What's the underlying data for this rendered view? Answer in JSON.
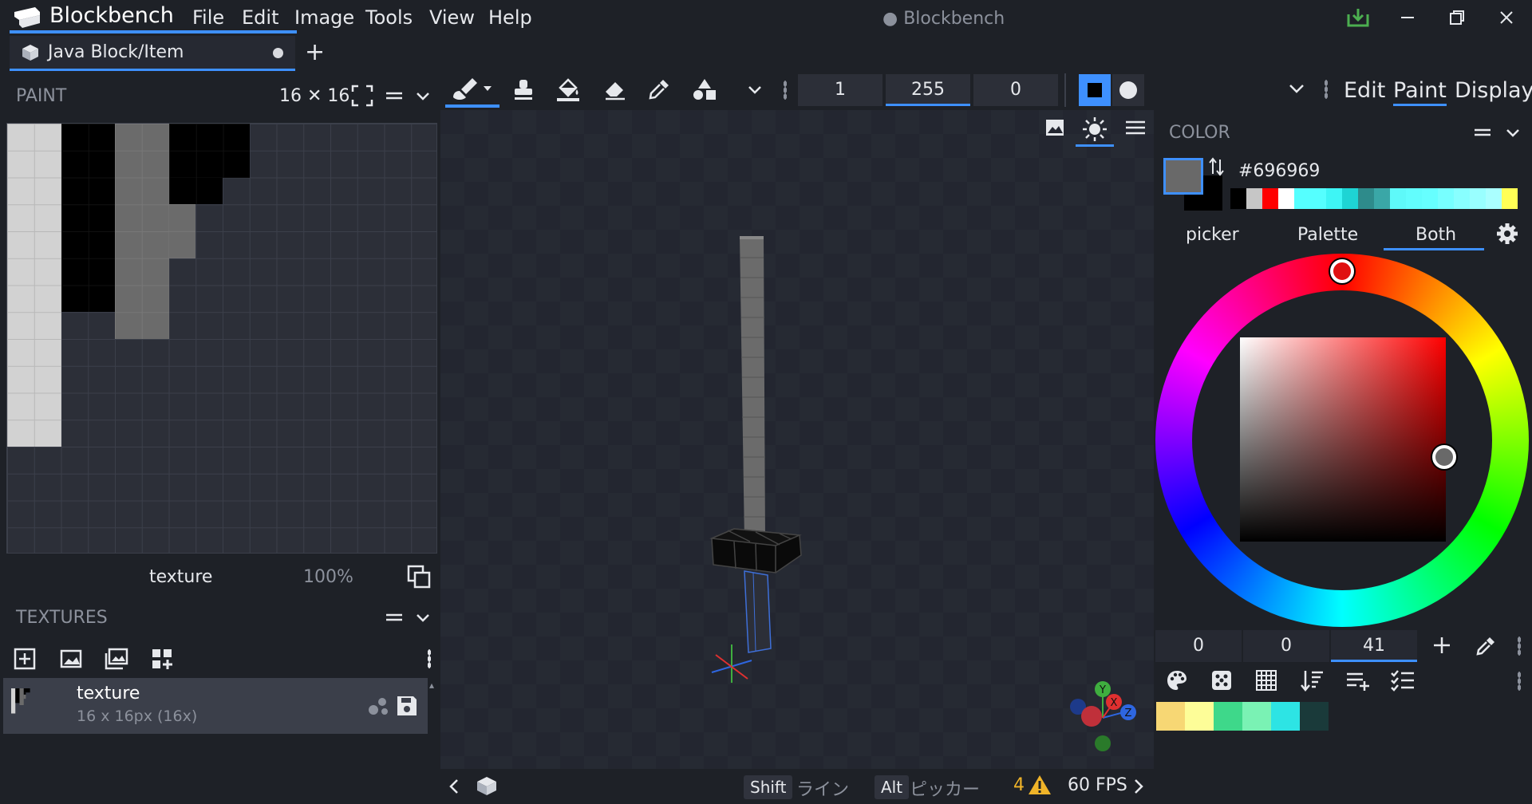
{
  "app": {
    "name": "Blockbench",
    "window_title": "Blockbench"
  },
  "menu": [
    "File",
    "Edit",
    "Image",
    "Tools",
    "View",
    "Help"
  ],
  "tabs": [
    {
      "label": "Java Block/Item"
    }
  ],
  "paint_panel": {
    "title": "PAINT",
    "size_label": "16 ✕ 16",
    "texture_name": "texture",
    "zoom": "100%"
  },
  "textures_panel": {
    "title": "TEXTURES",
    "items": [
      {
        "name": "texture",
        "meta": "16 x 16px (16x)"
      }
    ]
  },
  "toolbar": {
    "fields": [
      "1",
      "255",
      "0"
    ],
    "active_tool": "brush-tool",
    "brush_shape": "square"
  },
  "mode_tabs": [
    "Edit",
    "Paint",
    "Display"
  ],
  "active_mode": "Paint",
  "color_panel": {
    "title": "COLOR",
    "hex": "#696969",
    "tabs": [
      "picker",
      "Palette",
      "Both"
    ],
    "active_tab": "Both",
    "hsv": [
      "0",
      "0",
      "41"
    ],
    "palette": [
      "#000000",
      "#c6c6c6",
      "#ff0000",
      "#ffffff",
      "#55ffff",
      "#55ffff",
      "#3ef5f5",
      "#1ed4d4",
      "#2e8b8b",
      "#3aa7a7",
      "#5ef9f9",
      "#62fdfd",
      "#66ffff",
      "#77ffff",
      "#88ffff",
      "#99ffff",
      "#aaffff",
      "#ffff55"
    ],
    "swatches": [
      "#f7d774",
      "#fdfd98",
      "#3ed88a",
      "#7af2b4",
      "#2de4e4",
      "#1a3a3a"
    ]
  },
  "status": {
    "shift_key": "Shift",
    "shift_label": "ライン",
    "alt_key": "Alt",
    "alt_label": "ピッカー",
    "warnings": "4",
    "fps": "60 FPS"
  }
}
